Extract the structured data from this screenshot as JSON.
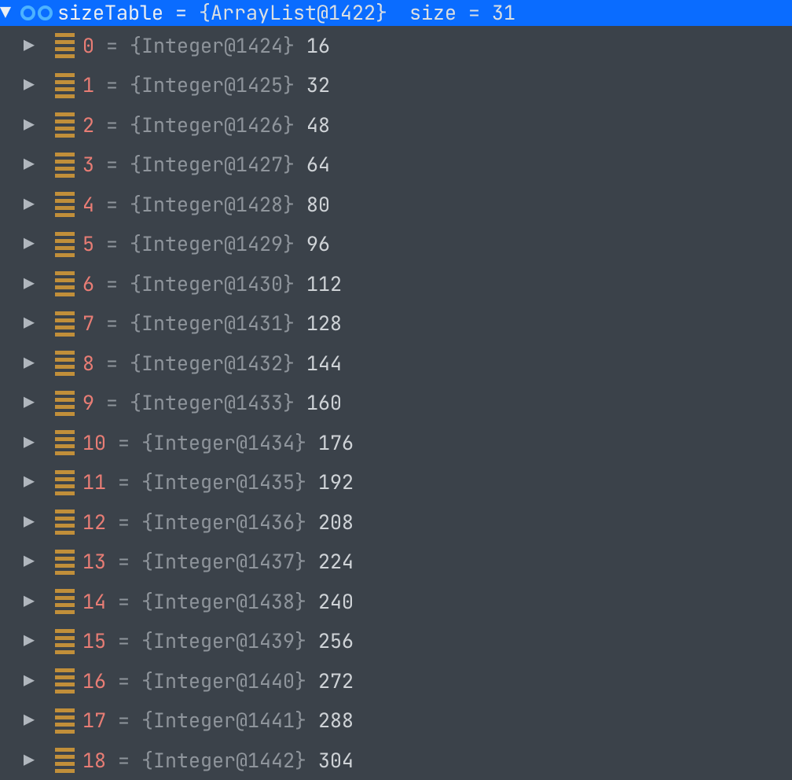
{
  "root": {
    "expanded": true,
    "varName": "sizeTable",
    "equals": " = ",
    "classRef": "{ArrayList@1422}",
    "sizeLabel": "size = 31"
  },
  "elements": [
    {
      "index": "0",
      "eq": " = ",
      "obj": "{Integer@1424}",
      "val": " 16"
    },
    {
      "index": "1",
      "eq": " = ",
      "obj": "{Integer@1425}",
      "val": " 32"
    },
    {
      "index": "2",
      "eq": " = ",
      "obj": "{Integer@1426}",
      "val": " 48"
    },
    {
      "index": "3",
      "eq": " = ",
      "obj": "{Integer@1427}",
      "val": " 64"
    },
    {
      "index": "4",
      "eq": " = ",
      "obj": "{Integer@1428}",
      "val": " 80"
    },
    {
      "index": "5",
      "eq": " = ",
      "obj": "{Integer@1429}",
      "val": " 96"
    },
    {
      "index": "6",
      "eq": " = ",
      "obj": "{Integer@1430}",
      "val": " 112"
    },
    {
      "index": "7",
      "eq": " = ",
      "obj": "{Integer@1431}",
      "val": " 128"
    },
    {
      "index": "8",
      "eq": " = ",
      "obj": "{Integer@1432}",
      "val": " 144"
    },
    {
      "index": "9",
      "eq": " = ",
      "obj": "{Integer@1433}",
      "val": " 160"
    },
    {
      "index": "10",
      "eq": " = ",
      "obj": "{Integer@1434}",
      "val": " 176"
    },
    {
      "index": "11",
      "eq": " = ",
      "obj": "{Integer@1435}",
      "val": " 192"
    },
    {
      "index": "12",
      "eq": " = ",
      "obj": "{Integer@1436}",
      "val": " 208"
    },
    {
      "index": "13",
      "eq": " = ",
      "obj": "{Integer@1437}",
      "val": " 224"
    },
    {
      "index": "14",
      "eq": " = ",
      "obj": "{Integer@1438}",
      "val": " 240"
    },
    {
      "index": "15",
      "eq": " = ",
      "obj": "{Integer@1439}",
      "val": " 256"
    },
    {
      "index": "16",
      "eq": " = ",
      "obj": "{Integer@1440}",
      "val": " 272"
    },
    {
      "index": "17",
      "eq": " = ",
      "obj": "{Integer@1441}",
      "val": " 288"
    },
    {
      "index": "18",
      "eq": " = ",
      "obj": "{Integer@1442}",
      "val": " 304"
    }
  ]
}
